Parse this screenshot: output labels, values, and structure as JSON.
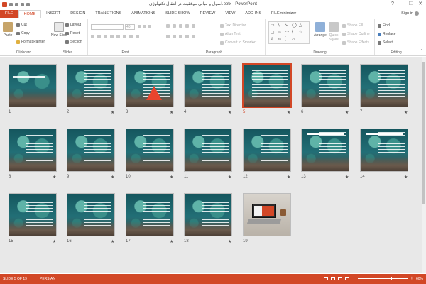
{
  "window": {
    "title": "اصول و مبانی موفقیت در انتقال تکنولوژی.pptx - PowerPoint",
    "controls": {
      "help": "?",
      "minimize": "—",
      "restore": "❐",
      "close": "✕"
    }
  },
  "tabs": [
    {
      "label": "FILE"
    },
    {
      "label": "HOME"
    },
    {
      "label": "INSERT"
    },
    {
      "label": "DESIGN"
    },
    {
      "label": "TRANSITIONS"
    },
    {
      "label": "ANIMATIONS"
    },
    {
      "label": "SLIDE SHOW"
    },
    {
      "label": "REVIEW"
    },
    {
      "label": "VIEW"
    },
    {
      "label": "ADD-INS"
    },
    {
      "label": "FILEminimizer"
    }
  ],
  "signin": "Sign in",
  "ribbon": {
    "clipboard": {
      "label": "Clipboard",
      "paste": "Paste",
      "cut": "Cut",
      "copy": "Copy",
      "format_painter": "Format Painter"
    },
    "slides": {
      "label": "Slides",
      "new_slide": "New Slide",
      "layout": "Layout",
      "reset": "Reset",
      "section": "Section"
    },
    "font": {
      "label": "Font",
      "font_size": "40"
    },
    "paragraph": {
      "label": "Paragraph",
      "text_direction": "Text Direction",
      "align_text": "Align Text",
      "convert_smartart": "Convert to SmartArt"
    },
    "drawing": {
      "label": "Drawing",
      "arrange": "Arrange",
      "quick_styles": "Quick Styles",
      "shape_fill": "Shape Fill",
      "shape_outline": "Shape Outline",
      "shape_effects": "Shape Effects"
    },
    "editing": {
      "label": "Editing",
      "find": "Find",
      "replace": "Replace",
      "select": "Select"
    }
  },
  "slides": [
    {
      "num": "1",
      "star": ""
    },
    {
      "num": "2",
      "star": "★"
    },
    {
      "num": "3",
      "star": "★"
    },
    {
      "num": "4",
      "star": "★"
    },
    {
      "num": "5",
      "star": "★"
    },
    {
      "num": "6",
      "star": "★"
    },
    {
      "num": "7",
      "star": "★"
    },
    {
      "num": "8",
      "star": "★"
    },
    {
      "num": "9",
      "star": "★"
    },
    {
      "num": "10",
      "star": "★"
    },
    {
      "num": "11",
      "star": "★"
    },
    {
      "num": "12",
      "star": "★"
    },
    {
      "num": "13",
      "star": "★"
    },
    {
      "num": "14",
      "star": "★"
    },
    {
      "num": "15",
      "star": "★"
    },
    {
      "num": "16",
      "star": "★"
    },
    {
      "num": "17",
      "star": "★"
    },
    {
      "num": "18",
      "star": "★"
    },
    {
      "num": "19",
      "star": ""
    }
  ],
  "status": {
    "slide_indicator": "SLIDE 5 OF 19",
    "language": "PERSIAN",
    "zoom": "60%"
  },
  "colors": {
    "accent": "#d24726"
  }
}
